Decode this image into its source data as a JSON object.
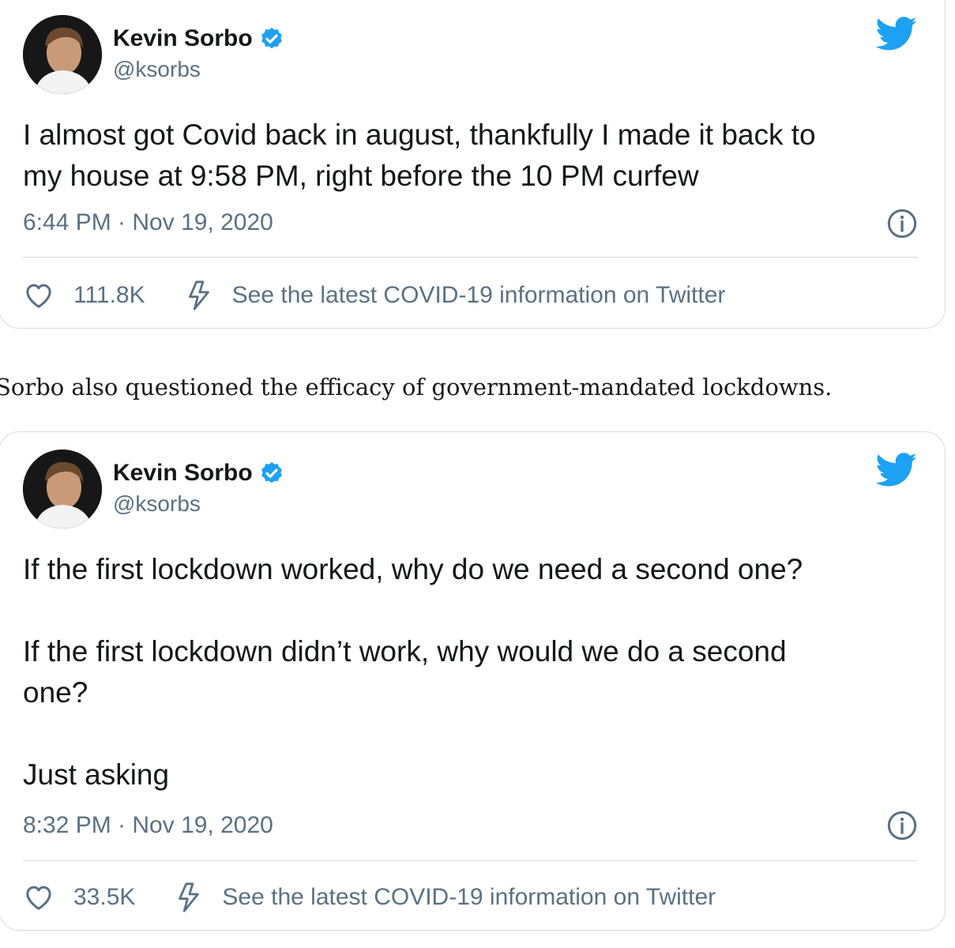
{
  "tweets": [
    {
      "display_name": "Kevin Sorbo",
      "handle": "@ksorbs",
      "text": "I almost got Covid back in august, thankfully I made it back to\nmy house at 9:58 PM, right before the 10 PM curfew",
      "timestamp": "6:44 PM · Nov 19, 2020",
      "likes": "111.8K",
      "covid_info": "See the latest COVID-19 information on Twitter"
    },
    {
      "display_name": "Kevin Sorbo",
      "handle": "@ksorbs",
      "text": "If the first lockdown worked, why do we need a second one?\n\nIf the first lockdown didn’t work, why would we do a second\none?\n\nJust asking",
      "timestamp": "8:32 PM · Nov 19, 2020",
      "likes": "33.5K",
      "covid_info": "See the latest COVID-19 information on Twitter"
    }
  ],
  "article": {
    "paragraph": "Sorbo also questioned the efficacy of government-mandated lockdowns."
  },
  "colors": {
    "twitter_blue": "#1da1f2",
    "secondary_text": "#5b7083",
    "border": "#d6dce0"
  },
  "icons": {
    "verified": "verified-badge-icon",
    "logo": "twitter-bird-icon",
    "info": "info-icon",
    "like": "heart-icon",
    "covid": "lightning-bolt-icon"
  }
}
